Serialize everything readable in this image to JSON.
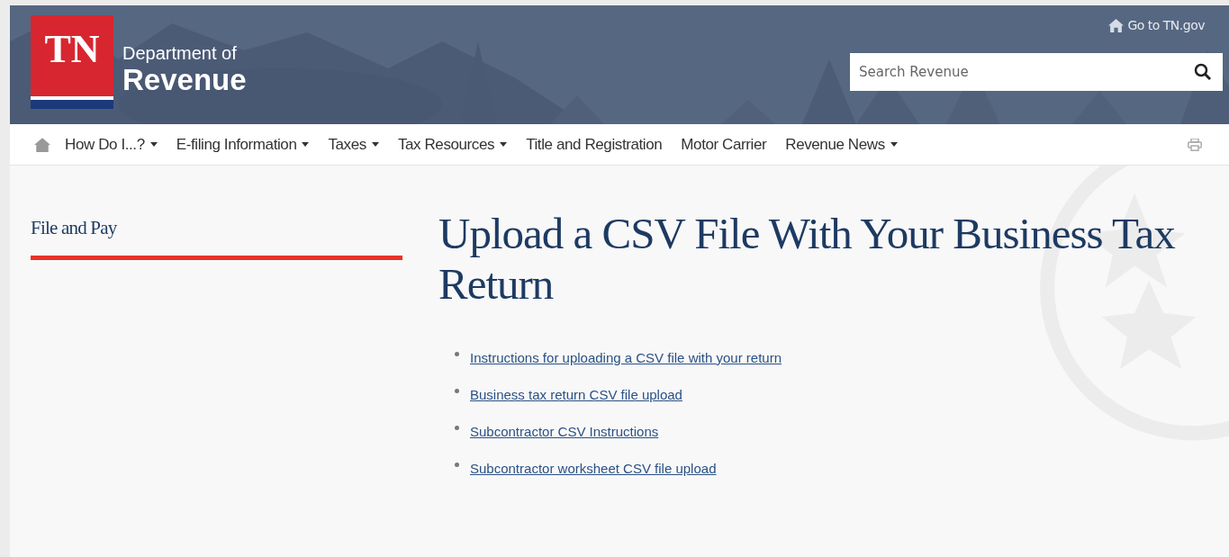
{
  "header": {
    "logo_mark": "TN",
    "department_line_1": "Department of",
    "department_line_2": "Revenue",
    "top_link": "Go to TN.gov",
    "search": {
      "placeholder": "Search Revenue"
    }
  },
  "nav": {
    "items": [
      {
        "label": "How Do I...?",
        "dropdown": true
      },
      {
        "label": "E-filing Information",
        "dropdown": true
      },
      {
        "label": "Taxes",
        "dropdown": true
      },
      {
        "label": "Tax Resources",
        "dropdown": true
      },
      {
        "label": "Title and Registration",
        "dropdown": false
      },
      {
        "label": "Motor Carrier",
        "dropdown": false
      },
      {
        "label": "Revenue News",
        "dropdown": true
      }
    ]
  },
  "sidebar": {
    "title": "File and Pay"
  },
  "main": {
    "title": "Upload a CSV File With Your Business Tax Return",
    "links": [
      "Instructions for uploading a CSV file with your return",
      "Business tax return CSV file upload",
      "Subcontractor CSV Instructions",
      "Subcontractor worksheet CSV file upload"
    ]
  }
}
